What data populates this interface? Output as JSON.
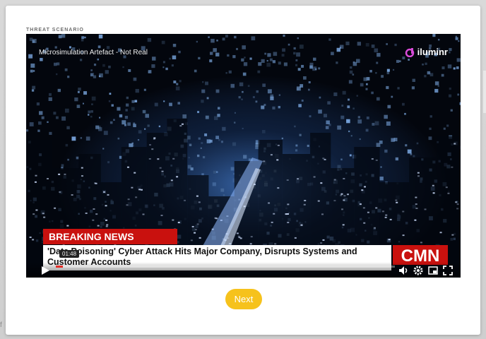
{
  "section_label": "THREAT SCENARIO",
  "video": {
    "title": "Microsimulation Artefact - Not Real",
    "brand": "iluminr",
    "breaking_label": "BREAKING NEWS",
    "headline": "'Data Poisoning' Cyber Attack Hits Major Company, Disrupts Systems and Customer Accounts",
    "network_logo": "CMN",
    "time_tooltip": "01:48",
    "progress": 0.02,
    "colors": {
      "breaking": "#c9110e",
      "progress": "#e52d27"
    }
  },
  "next_label": "Next",
  "colors": {
    "next_button": "#f6c21c"
  }
}
